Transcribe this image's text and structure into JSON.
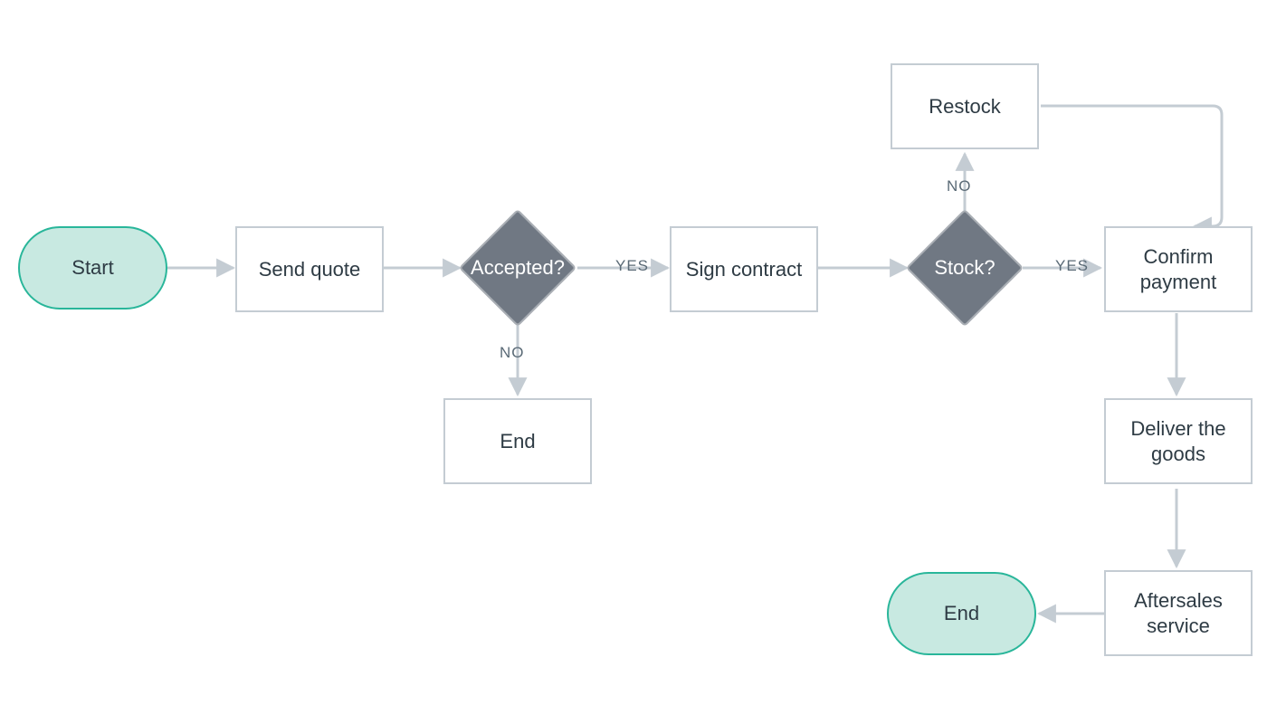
{
  "nodes": {
    "start": {
      "label": "Start"
    },
    "send_quote": {
      "label": "Send quote"
    },
    "accepted": {
      "label": "Accepted?"
    },
    "end1": {
      "label": "End"
    },
    "sign_contract": {
      "label": "Sign contract"
    },
    "stock": {
      "label": "Stock?"
    },
    "restock": {
      "label": "Restock"
    },
    "confirm_pay": {
      "label": "Confirm payment"
    },
    "deliver": {
      "label": "Deliver the goods"
    },
    "aftersales": {
      "label": "Aftersales service"
    },
    "end2": {
      "label": "End"
    }
  },
  "edge_labels": {
    "accepted_yes": "YES",
    "accepted_no": "NO",
    "stock_yes": "YES",
    "stock_no": "NO"
  },
  "colors": {
    "terminator_fill": "#c8e9e1",
    "terminator_stroke": "#29b69a",
    "process_stroke": "#c4ccd3",
    "decision_fill": "#707883",
    "arrow": "#c4ccd3",
    "text": "#2e3b44"
  }
}
